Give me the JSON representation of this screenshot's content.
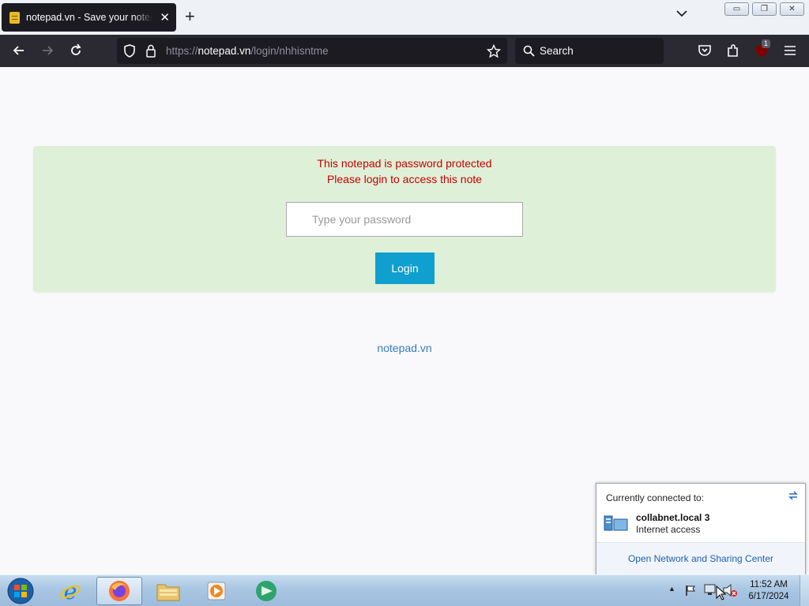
{
  "browser": {
    "tab": {
      "title": "notepad.vn - Save your notes, s",
      "close": "✕"
    },
    "new_tab": "+",
    "url": {
      "prefix": "https://",
      "host": "notepad.vn",
      "path": "/login/nhhisntme"
    },
    "search_placeholder": "Search",
    "extension_badge": "1"
  },
  "window_controls": {
    "minimize": "▭",
    "restore": "❐",
    "close": "✕"
  },
  "page": {
    "message_line1": "This notepad is password protected",
    "message_line2": "Please login to access this note",
    "password_placeholder": "Type your password",
    "login_label": "Login",
    "footer_link": "notepad.vn"
  },
  "network_flyout": {
    "header": "Currently connected to:",
    "network_name": "collabnet.local  3",
    "network_status": "Internet access",
    "link": "Open Network and Sharing Center"
  },
  "taskbar": {
    "time": "11:52 AM",
    "date": "6/17/2024",
    "apps": [
      "start-orb",
      "internet-explorer",
      "firefox",
      "windows-explorer",
      "media-player",
      "app"
    ]
  },
  "colors": {
    "panel_bg": "#dff0d8",
    "error_text": "#c40000",
    "login_button": "#0fa0cf",
    "link": "#3a7bc0"
  }
}
